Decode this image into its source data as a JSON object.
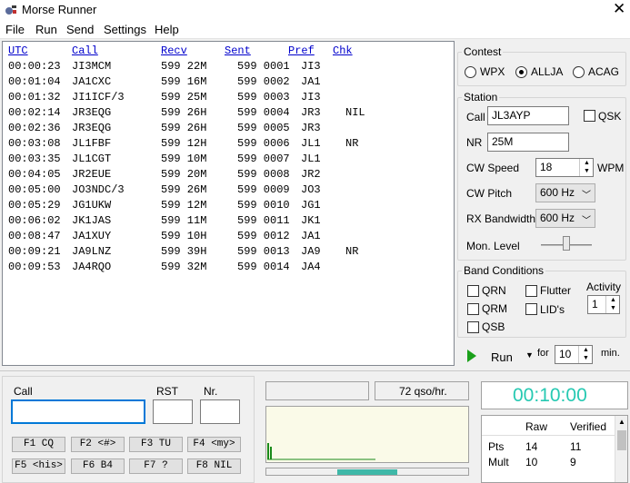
{
  "window": {
    "title": "Morse Runner"
  },
  "menu": [
    "File",
    "Run",
    "Send",
    "Settings",
    "Help"
  ],
  "log": {
    "headers": [
      "UTC",
      "Call",
      "Recv",
      "Sent",
      "Pref",
      "Chk"
    ],
    "rows": [
      {
        "utc": "00:00:23",
        "call": "JI3MCM",
        "recv": "599 22M",
        "sent": "599 0001",
        "pref": "JI3",
        "chk": ""
      },
      {
        "utc": "00:01:04",
        "call": "JA1CXC",
        "recv": "599 16M",
        "sent": "599 0002",
        "pref": "JA1",
        "chk": ""
      },
      {
        "utc": "00:01:32",
        "call": "JI1ICF/3",
        "recv": "599 25M",
        "sent": "599 0003",
        "pref": "JI3",
        "chk": ""
      },
      {
        "utc": "00:02:14",
        "call": "JR3EQG",
        "recv": "599 26H",
        "sent": "599 0004",
        "pref": "JR3",
        "chk": "NIL"
      },
      {
        "utc": "00:02:36",
        "call": "JR3EQG",
        "recv": "599 26H",
        "sent": "599 0005",
        "pref": "JR3",
        "chk": ""
      },
      {
        "utc": "00:03:08",
        "call": "JL1FBF",
        "recv": "599 12H",
        "sent": "599 0006",
        "pref": "JL1",
        "chk": "NR"
      },
      {
        "utc": "00:03:35",
        "call": "JL1CGT",
        "recv": "599 10M",
        "sent": "599 0007",
        "pref": "JL1",
        "chk": ""
      },
      {
        "utc": "00:04:05",
        "call": "JR2EUE",
        "recv": "599 20M",
        "sent": "599 0008",
        "pref": "JR2",
        "chk": ""
      },
      {
        "utc": "00:05:00",
        "call": "JO3NDC/3",
        "recv": "599 26M",
        "sent": "599 0009",
        "pref": "JO3",
        "chk": ""
      },
      {
        "utc": "00:05:29",
        "call": "JG1UKW",
        "recv": "599 12M",
        "sent": "599 0010",
        "pref": "JG1",
        "chk": ""
      },
      {
        "utc": "00:06:02",
        "call": "JK1JAS",
        "recv": "599 11M",
        "sent": "599 0011",
        "pref": "JK1",
        "chk": ""
      },
      {
        "utc": "00:08:47",
        "call": "JA1XUY",
        "recv": "599 10H",
        "sent": "599 0012",
        "pref": "JA1",
        "chk": ""
      },
      {
        "utc": "00:09:21",
        "call": "JA9LNZ",
        "recv": "599 39H",
        "sent": "599 0013",
        "pref": "JA9",
        "chk": "NR"
      },
      {
        "utc": "00:09:53",
        "call": "JA4RQO",
        "recv": "599 32M",
        "sent": "599 0014",
        "pref": "JA4",
        "chk": ""
      }
    ]
  },
  "contest": {
    "title": "Contest",
    "options": [
      {
        "label": "WPX",
        "selected": false
      },
      {
        "label": "ALLJA",
        "selected": true
      },
      {
        "label": "ACAG",
        "selected": false
      }
    ]
  },
  "station": {
    "title": "Station",
    "call_label": "Call",
    "call_value": "JL3AYP",
    "qsk_label": "QSK",
    "nr_label": "NR",
    "nr_value": "25M",
    "cw_speed_label": "CW Speed",
    "cw_speed_value": "18",
    "wpm_label": "WPM",
    "cw_pitch_label": "CW Pitch",
    "cw_pitch_value": "600 Hz",
    "rx_bw_label": "RX Bandwidth",
    "rx_bw_value": "600 Hz",
    "mon_level_label": "Mon. Level",
    "mon_level_fraction": 0.5
  },
  "band": {
    "title": "Band Conditions",
    "qrn": "QRN",
    "qrm": "QRM",
    "qsb": "QSB",
    "flutter": "Flutter",
    "lids": "LID's",
    "activity_label": "Activity",
    "activity_value": "1"
  },
  "run": {
    "run_label": "Run",
    "for_label": "for",
    "minutes_value": "10",
    "min_label": "min."
  },
  "entry": {
    "call_label": "Call",
    "rst_label": "RST",
    "nr_label": "Nr.",
    "call_value": "",
    "rst_value": "",
    "nr_value": ""
  },
  "fkeys": [
    "F1 CQ",
    "F2 <#>",
    "F3 TU",
    "F4 <my>",
    "F5 <his>",
    "F6 B4",
    "F7 ?",
    "F8 NIL"
  ],
  "rate": {
    "value": "72 qso/hr."
  },
  "clock": {
    "value": "00:10:00"
  },
  "score": {
    "headers": [
      "",
      "Raw",
      "Verified"
    ],
    "rows": [
      {
        "label": "Pts",
        "raw": "14",
        "verified": "11"
      },
      {
        "label": "Mult",
        "raw": "10",
        "verified": "9"
      }
    ]
  },
  "colors": {
    "clock_text": "#26c9b2",
    "log_header": "#0000cc",
    "run_icon": "#1aa01a",
    "panel_bg": "#fafae8"
  }
}
